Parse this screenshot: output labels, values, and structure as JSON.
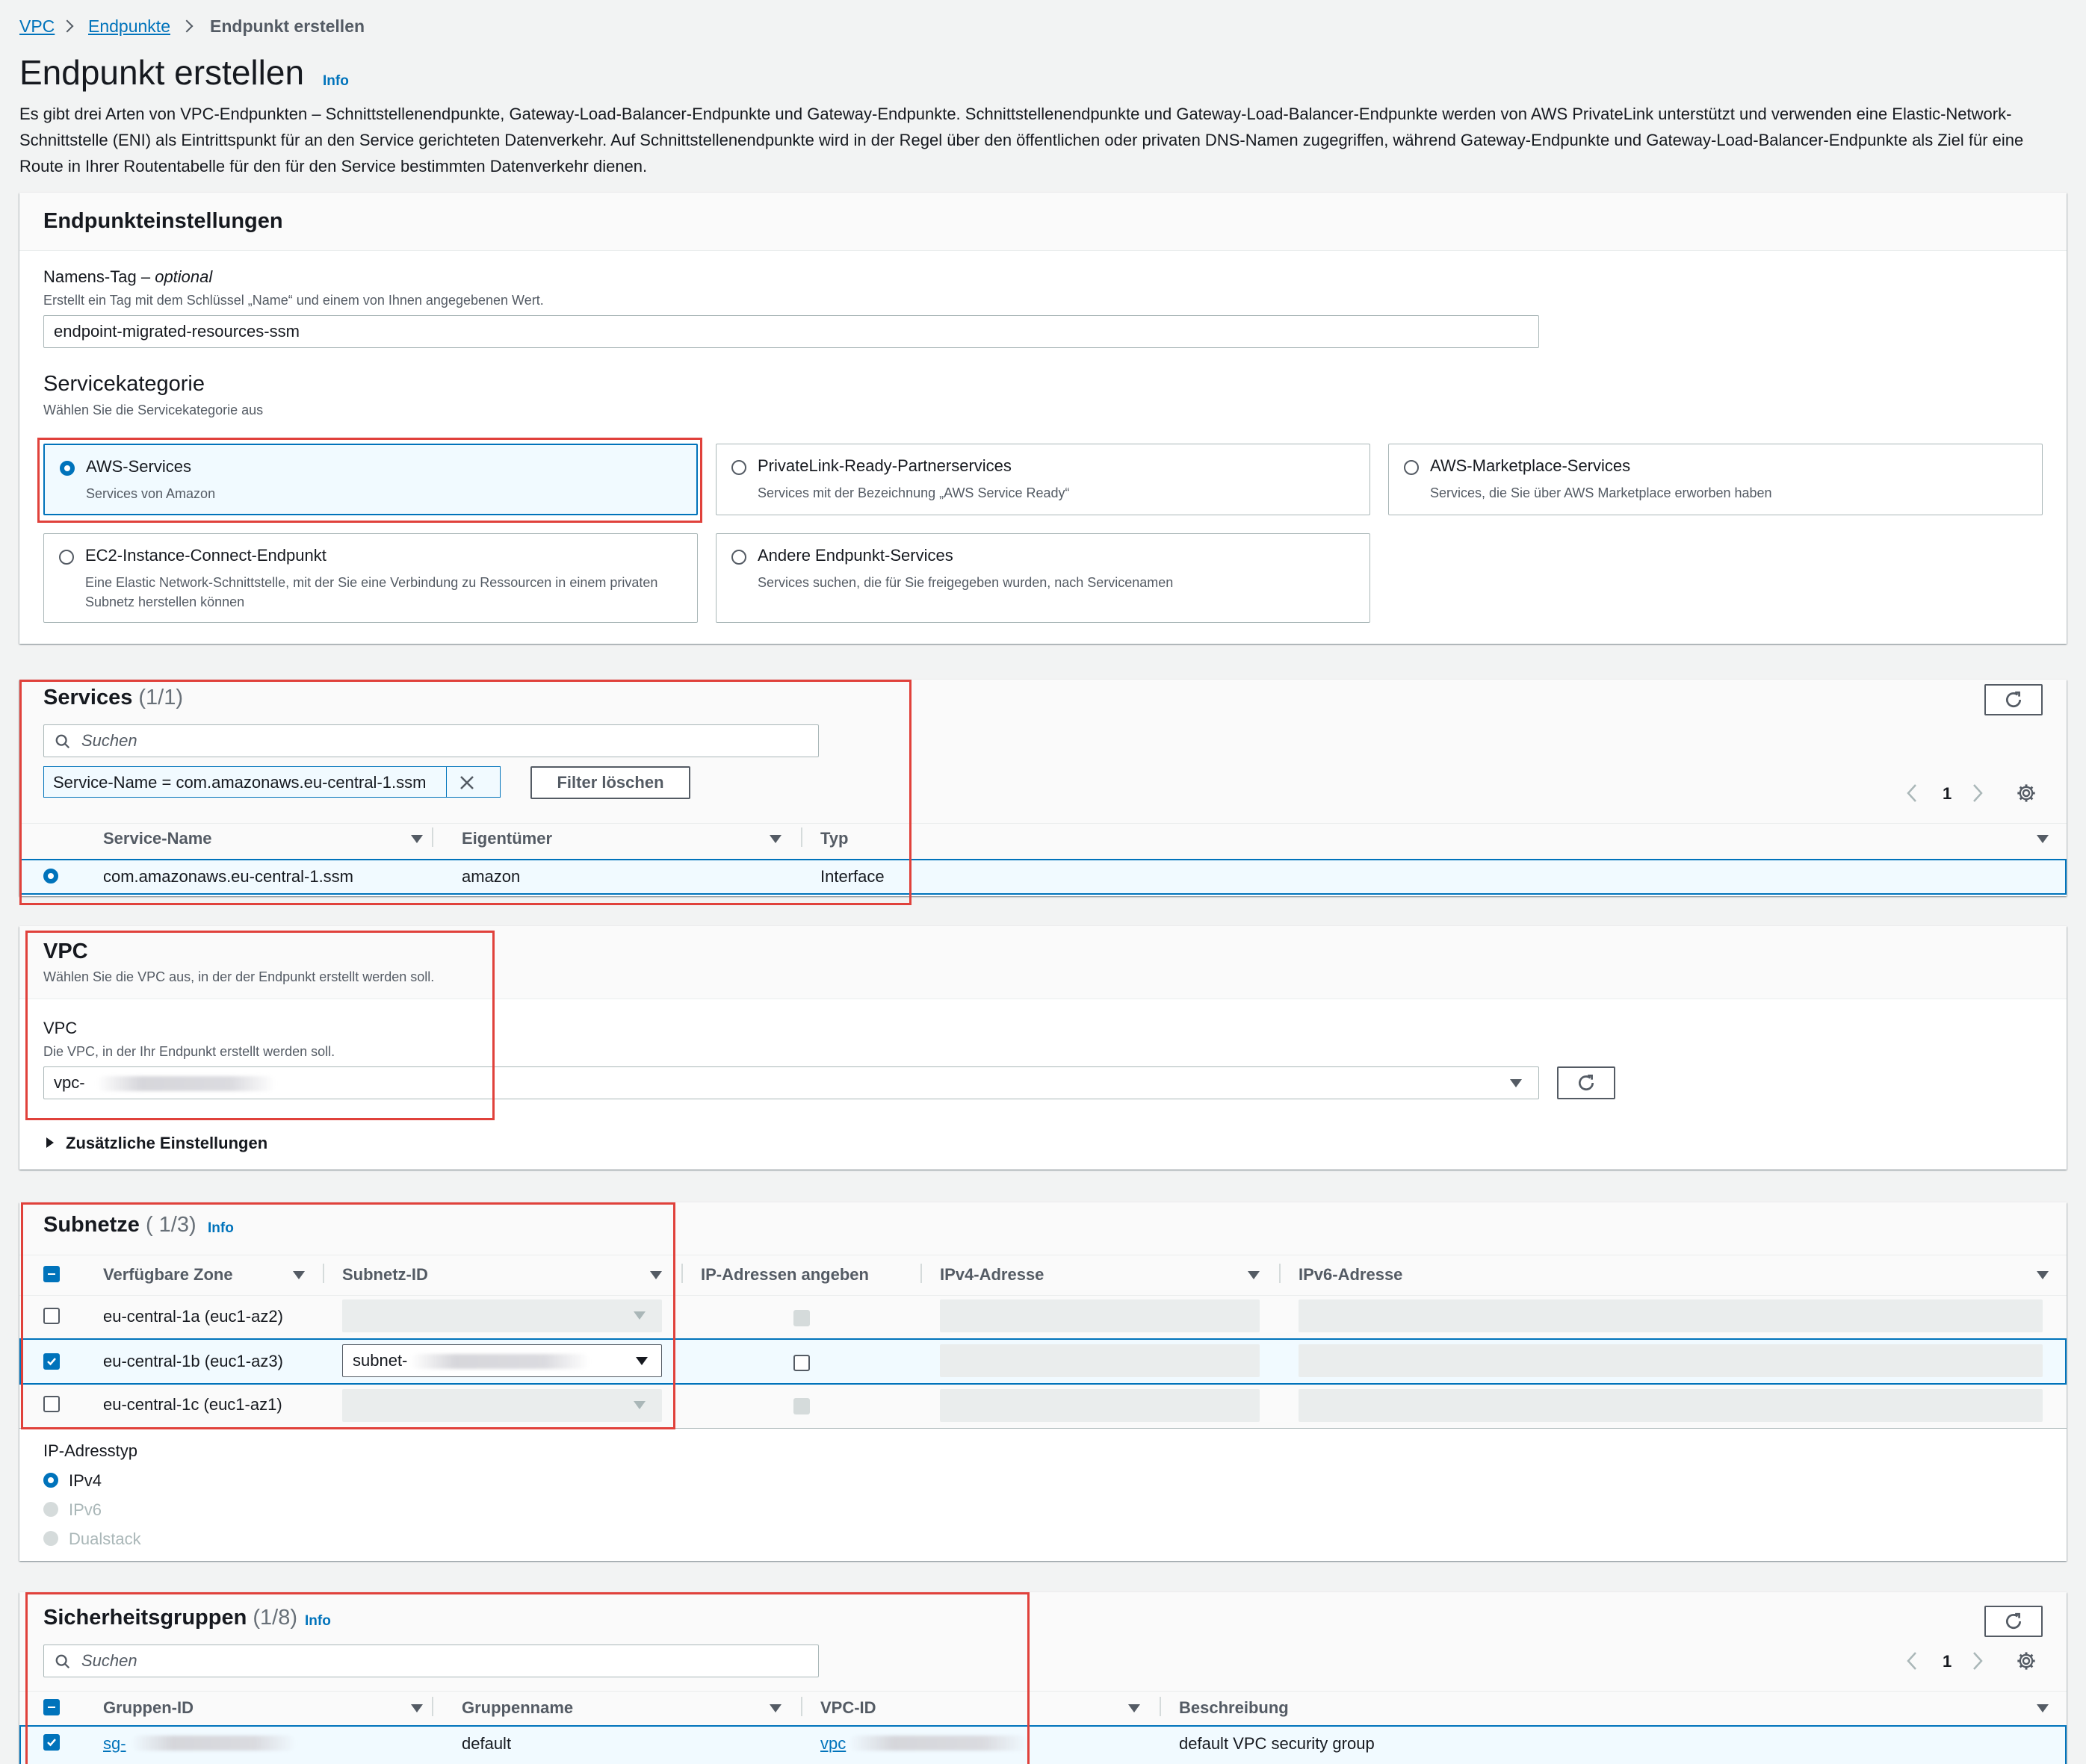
{
  "breadcrumb": {
    "vpc": "VPC",
    "endpoints": "Endpunkte",
    "current": "Endpunkt erstellen"
  },
  "page": {
    "title": "Endpunkt erstellen",
    "info": "Info",
    "description": "Es gibt drei Arten von VPC-Endpunkten – Schnittstellenendpunkte, Gateway-Load-Balancer-Endpunkte und Gateway-Endpunkte. Schnittstellenendpunkte und Gateway-Load-Balancer-Endpunkte werden von AWS PrivateLink unterstützt und verwenden eine Elastic-Network-Schnittstelle (ENI) als Eintrittspunkt für an den Service gerichteten Datenverkehr. Auf Schnittstellenendpunkte wird in der Regel über den öffentlichen oder privaten DNS-Namen zugegriffen, während Gateway-Endpunkte und Gateway-Load-Balancer-Endpunkte als Ziel für eine Route in Ihrer Routentabelle für den für den Service bestimmten Datenverkehr dienen."
  },
  "settings": {
    "title": "Endpunkteinstellungen",
    "name_label": "Namens-Tag –",
    "name_optional": "optional",
    "name_desc": "Erstellt ein Tag mit dem Schlüssel „Name“ und einem von Ihnen angegebenen Wert.",
    "name_value": "endpoint-migrated-resources-ssm",
    "category_title": "Servicekategorie",
    "category_desc": "Wählen Sie die Servicekategorie aus",
    "categories": [
      {
        "title": "AWS-Services",
        "desc": "Services von Amazon",
        "selected": true
      },
      {
        "title": "PrivateLink-Ready-Partnerservices",
        "desc": "Services mit der Bezeichnung „AWS Service Ready“",
        "selected": false
      },
      {
        "title": "AWS-Marketplace-Services",
        "desc": "Services, die Sie über AWS Marketplace erworben haben",
        "selected": false
      },
      {
        "title": "EC2-Instance-Connect-Endpunkt",
        "desc": "Eine Elastic Network-Schnittstelle, mit der Sie eine Verbindung zu Ressourcen in einem privaten Subnetz herstellen können",
        "selected": false
      },
      {
        "title": "Andere Endpunkt-Services",
        "desc": "Services suchen, die für Sie freigegeben wurden, nach Servicenamen",
        "selected": false
      }
    ]
  },
  "services": {
    "title": "Services",
    "count": "(1/1)",
    "search_placeholder": "Suchen",
    "filter_token": "Service-Name = com.amazonaws.eu-central-1.ssm",
    "clear_filter": "Filter löschen",
    "page": "1",
    "columns": [
      "Service-Name",
      "Eigentümer",
      "Typ"
    ],
    "rows": [
      {
        "name": "com.amazonaws.eu-central-1.ssm",
        "owner": "amazon",
        "type": "Interface"
      }
    ]
  },
  "vpc": {
    "title": "VPC",
    "desc": "Wählen Sie die VPC aus, in der der Endpunkt erstellt werden soll.",
    "field_label": "VPC",
    "field_desc": "Die VPC, in der Ihr Endpunkt erstellt werden soll.",
    "value": "vpc-",
    "additional": "Zusätzliche Einstellungen"
  },
  "subnets": {
    "title": "Subnetze",
    "count": "( 1/3)",
    "info": "Info",
    "columns": [
      "Verfügbare Zone",
      "Subnetz-ID",
      "IP-Adressen angeben",
      "IPv4-Adresse",
      "IPv6-Adresse"
    ],
    "rows": [
      {
        "zone": "eu-central-1a (euc1-az2)",
        "subnet": "",
        "checked": false
      },
      {
        "zone": "eu-central-1b (euc1-az3)",
        "subnet": "subnet-",
        "checked": true
      },
      {
        "zone": "eu-central-1c (euc1-az1)",
        "subnet": "",
        "checked": false
      }
    ],
    "ip_type_label": "IP-Adresstyp",
    "ip_types": [
      "IPv4",
      "IPv6",
      "Dualstack"
    ]
  },
  "security_groups": {
    "title": "Sicherheitsgruppen",
    "count": "(1/8)",
    "info": "Info",
    "search_placeholder": "Suchen",
    "page": "1",
    "columns": [
      "Gruppen-ID",
      "Gruppenname",
      "VPC-ID",
      "Beschreibung"
    ],
    "rows": [
      {
        "id": "sg-",
        "name": "default",
        "vpc": "vpc",
        "desc": "default VPC security group"
      }
    ]
  }
}
